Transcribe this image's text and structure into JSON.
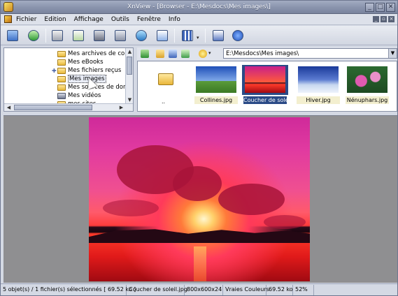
{
  "window": {
    "title": "XnView - [Browser - E:\\Mesdocs\\Mes images\\]",
    "controls": [
      "minimize",
      "maximize",
      "close"
    ]
  },
  "menu": {
    "items": [
      "Fichier",
      "Edition",
      "Affichage",
      "Outils",
      "Fenêtre",
      "Info"
    ]
  },
  "toolbar": {
    "buttons": [
      "browser-icon",
      "refresh-icon",
      "print-icon",
      "convert-icon",
      "capture-icon",
      "scan-icon",
      "web-icon",
      "slideshow-icon",
      "view-mode-icon",
      "options-icon",
      "about-icon"
    ]
  },
  "tree": {
    "items": [
      {
        "label": "Mes archives de conver",
        "expandable": false
      },
      {
        "label": "Mes eBooks",
        "expandable": false
      },
      {
        "label": "Mes fichiers reçus",
        "expandable": true
      },
      {
        "label": "Mes images",
        "expandable": false,
        "selected": true
      },
      {
        "label": "Mes sources de donnée",
        "expandable": false
      },
      {
        "label": "Mes vidéos",
        "expandable": false
      },
      {
        "label": "mes sites",
        "expandable": false
      }
    ]
  },
  "browser": {
    "path": "E:\\Mesdocs\\Mes images\\",
    "parent_label": "..",
    "thumbnails": [
      {
        "name": "Collines.jpg",
        "selected": false,
        "colors": [
          "#1f4fb8",
          "#7fa8e8"
        ]
      },
      {
        "name": "Coucher de solei...",
        "selected": true,
        "colors": [
          "#c8208a",
          "#ff5a3a"
        ]
      },
      {
        "name": "Hiver.jpg",
        "selected": false,
        "colors": [
          "#1a3a9a",
          "#c8d8f0"
        ]
      },
      {
        "name": "Nénuphars.jpg",
        "selected": false,
        "colors": [
          "#1e6a2a",
          "#e05ab0"
        ]
      }
    ]
  },
  "status": {
    "selection": "5 objet(s) / 1 fichier(s) sélectionnés",
    "selection_size": "[ 69.52 ko ]",
    "file_name": "Coucher de soleil.jpg",
    "dimensions": "800x600x24",
    "color_mode": "Vraies Couleurs",
    "file_size": "69.52 ko",
    "zoom": "52%"
  }
}
